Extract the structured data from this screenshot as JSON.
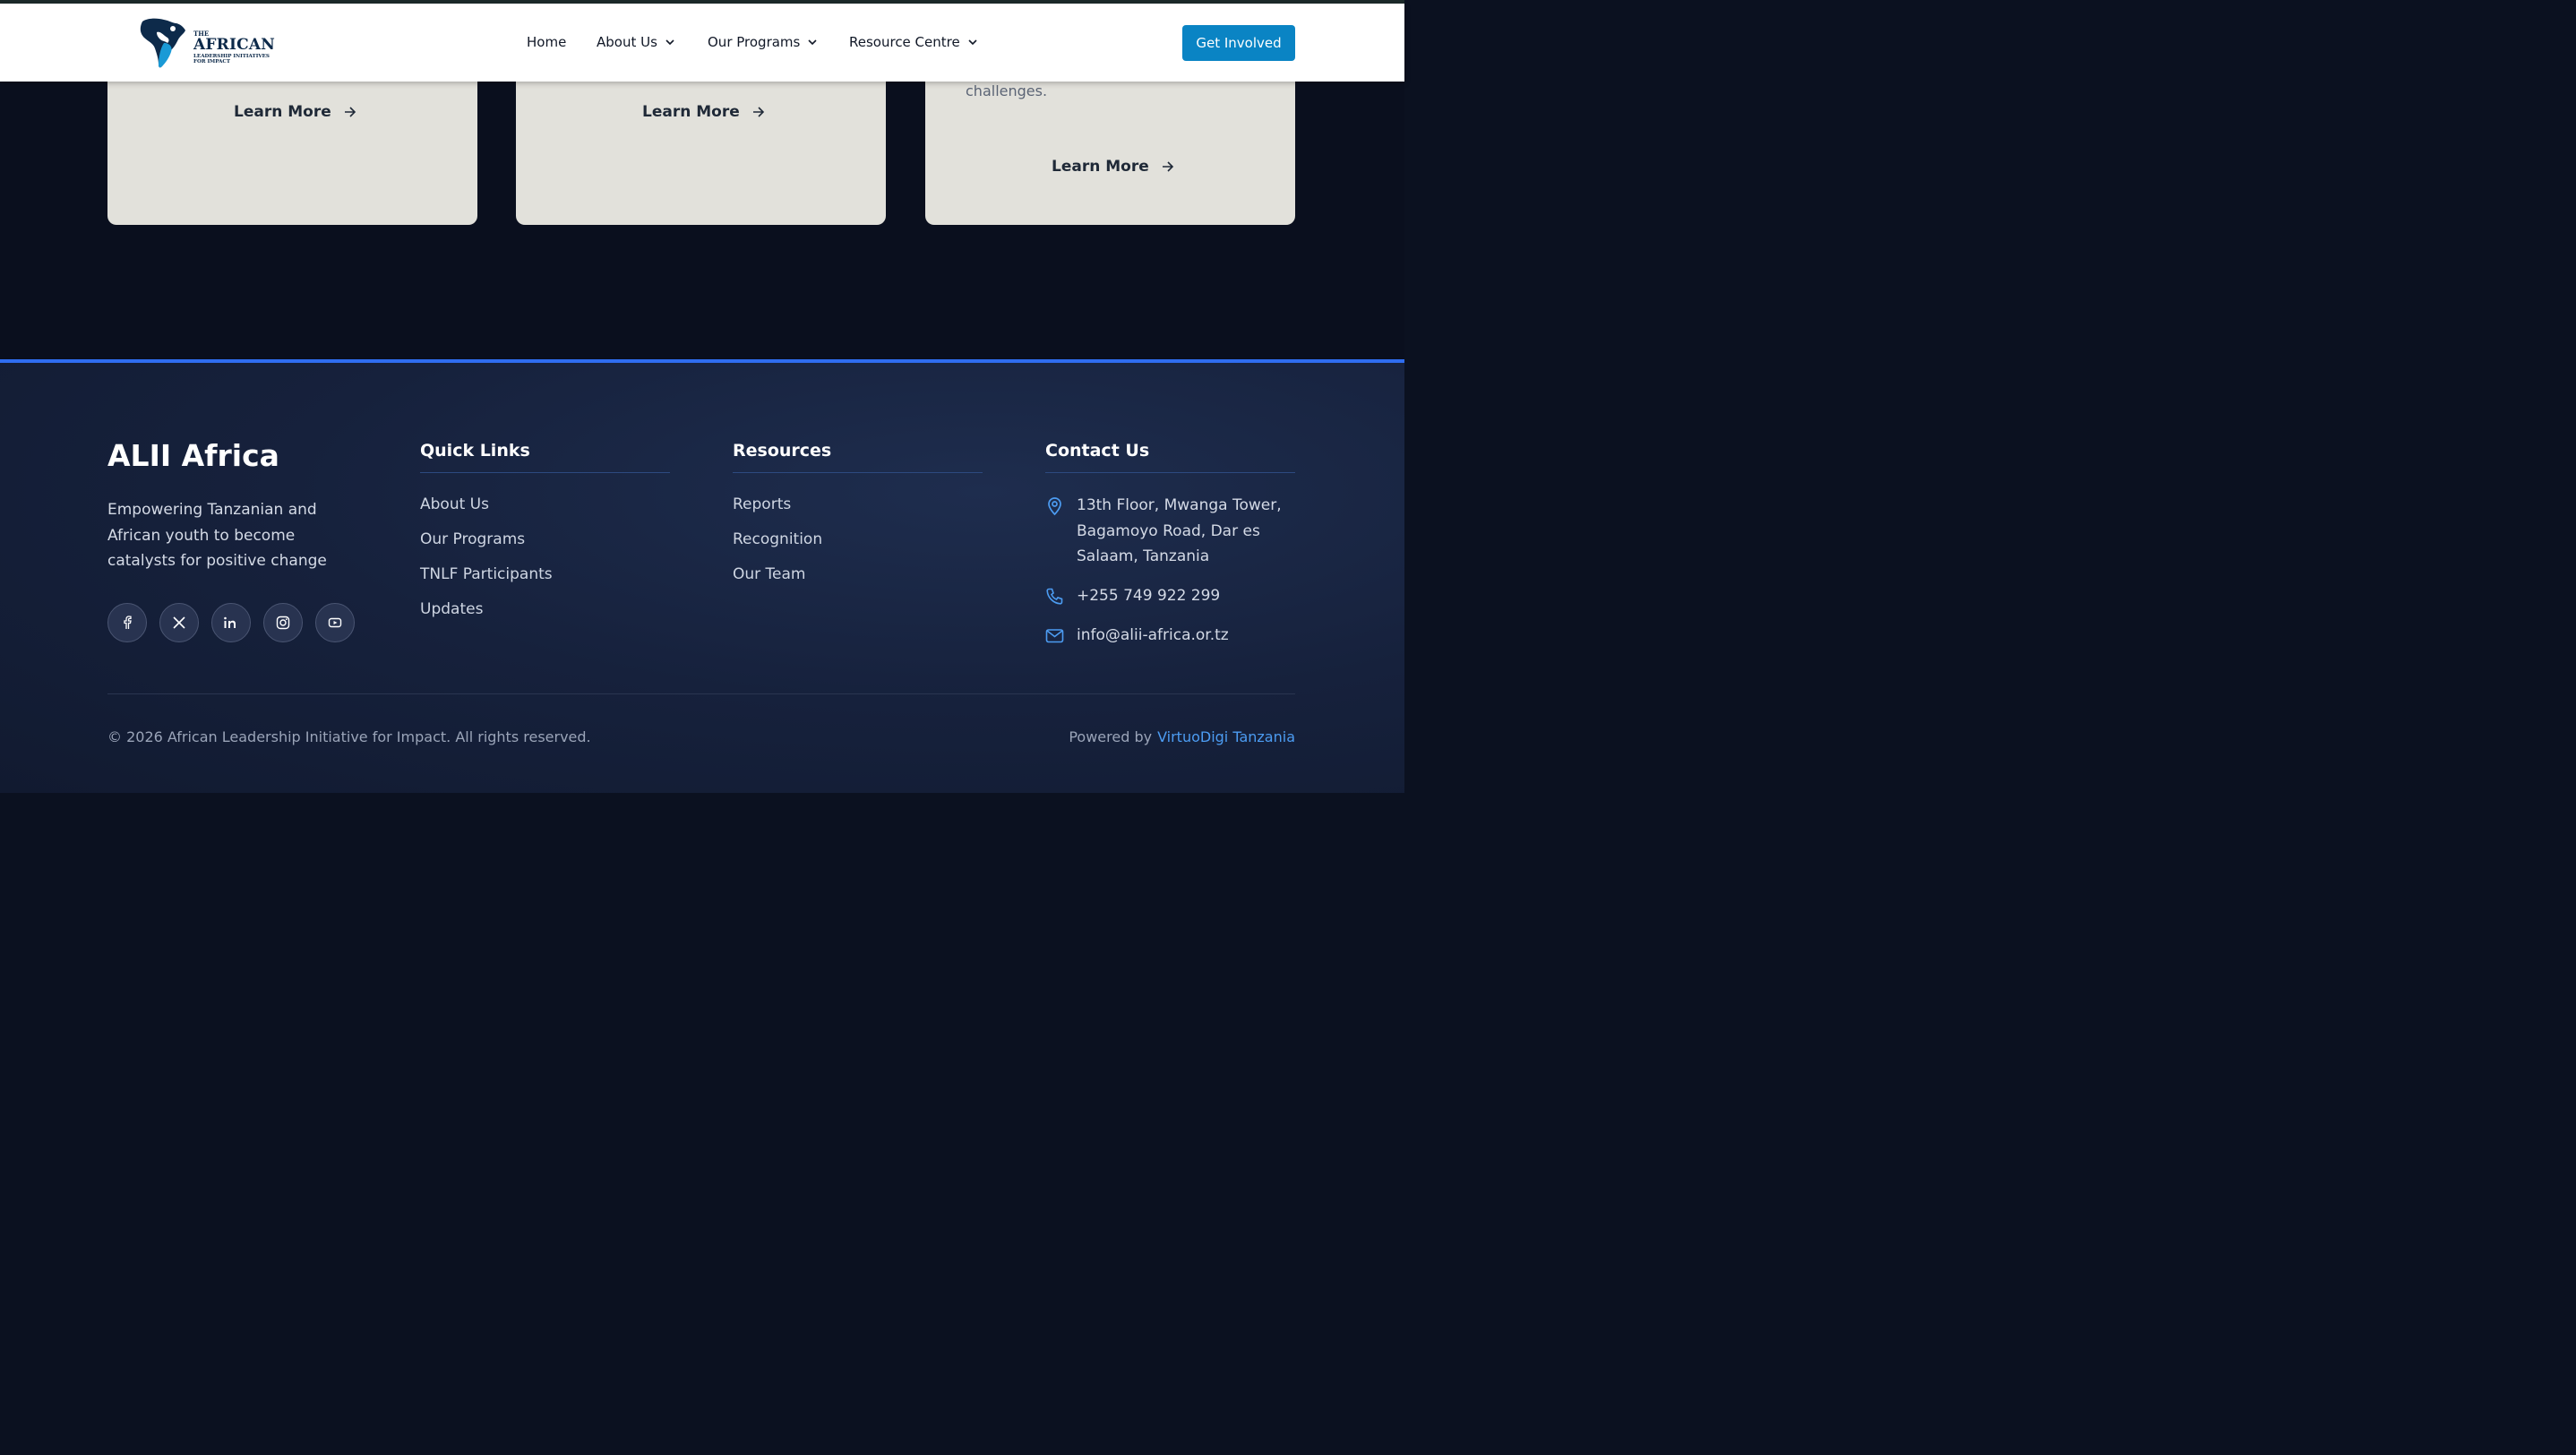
{
  "brand_colors": {
    "primary_button": "#0a84c4",
    "accent_blue": "#2f6df0",
    "link_blue": "#4c9cf2"
  },
  "header": {
    "logo": {
      "the": "THE",
      "african": "AFRICAN",
      "sub1": "LEADERSHIP INITIATIVES",
      "sub2": "FOR IMPACT"
    },
    "nav": [
      {
        "label": "Home",
        "has_dropdown": false
      },
      {
        "label": "About Us",
        "has_dropdown": true
      },
      {
        "label": "Our Programs",
        "has_dropdown": true
      },
      {
        "label": "Resource Centre",
        "has_dropdown": true
      }
    ],
    "cta_label": "Get Involved"
  },
  "cards": [
    {
      "snippet": "",
      "link_label": "Learn More"
    },
    {
      "snippet": "",
      "link_label": "Learn More"
    },
    {
      "snippet": "challenges.",
      "link_label": "Learn More"
    }
  ],
  "footer": {
    "brand": "ALII Africa",
    "tagline": "Empowering Tanzanian and African youth to become catalysts for positive change",
    "socials": [
      "facebook-icon",
      "x-icon",
      "linkedin-icon",
      "instagram-icon",
      "youtube-icon"
    ],
    "quick_links": {
      "title": "Quick Links",
      "items": [
        "About Us",
        "Our Programs",
        "TNLF Participants",
        "Updates"
      ]
    },
    "resources": {
      "title": "Resources",
      "items": [
        "Reports",
        "Recognition",
        "Our Team"
      ]
    },
    "contact": {
      "title": "Contact Us",
      "address": "13th Floor, Mwanga Tower, Bagamoyo Road, Dar es Salaam, Tanzania",
      "phone": "+255 749 922 299",
      "email": "info@alii-africa.or.tz"
    },
    "copyright": "© 2026 African Leadership Initiative for Impact. All rights reserved.",
    "powered_by_label": "Powered by",
    "powered_by_link": "VirtuoDigi Tanzania"
  }
}
